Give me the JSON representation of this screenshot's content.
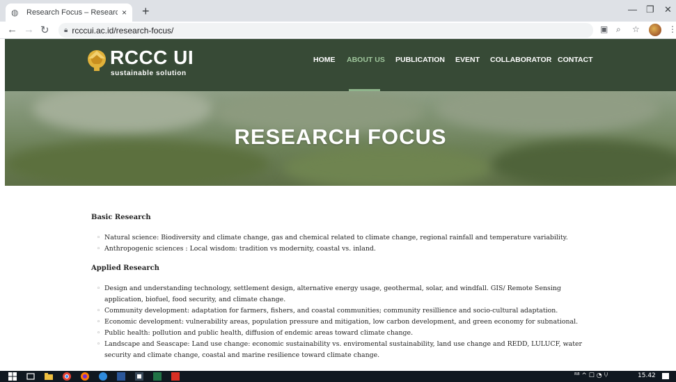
{
  "browser": {
    "tab_title": "Research Focus – Research Cente",
    "tab_close": "×",
    "new_tab": "+",
    "url": "rcccui.ac.id/research-focus/",
    "icons": [
      "globe-icon",
      "back-icon",
      "forward-icon",
      "reload-icon",
      "lock-icon",
      "translate-icon",
      "zoom-icon",
      "star-icon",
      "menu-icon"
    ]
  },
  "site": {
    "logo_title": "RCCC UI",
    "logo_subtitle": "sustainable solution",
    "nav": [
      "HOME",
      "ABOUT US",
      "PUBLICATION",
      "EVENT",
      "COLLABORATOR",
      "CONTACT"
    ],
    "active_nav": "ABOUT US",
    "hero_title": "RESEARCH FOCUS",
    "colors": {
      "header": "#374a36",
      "active_nav": "#9fc69c"
    }
  },
  "content": {
    "basic_heading": "Basic Research",
    "basic_items": [
      "Natural science: Biodiversity and climate change, gas and chemical related to climate change, regional rainfall and temperature variability.",
      "Anthropogenic sciences : Local wisdom: tradition vs modernity, coastal vs. inland."
    ],
    "applied_heading": "Applied Research",
    "applied_items": [
      "Design and understanding technology, settlement design, alternative energy usage, geothermal, solar, and windfall. GIS/ Remote Sensing application, biofuel, food security, and climate change.",
      "Community development: adaptation for farmers, fishers, and coastal communities; community resillience and socio-cultural adaptation.",
      "Economic development: vulnerability areas, population pressure and mitigation, low carbon development, and green economy for subnational.",
      "Public health: pollution and public health, diffusion of endemic areas toward climate change.",
      "Landscape and Seascape: Land use change: economic sustainability vs. enviromental sustainability, land use change and REDD, LULUCF, water security and climate change, coastal and marine resilience toward climate change."
    ]
  },
  "taskbar": {
    "time": "15.42",
    "tray_text": "ᴿ⁸  ^  ☐  ◔  ⁽ᵢ⁾"
  }
}
